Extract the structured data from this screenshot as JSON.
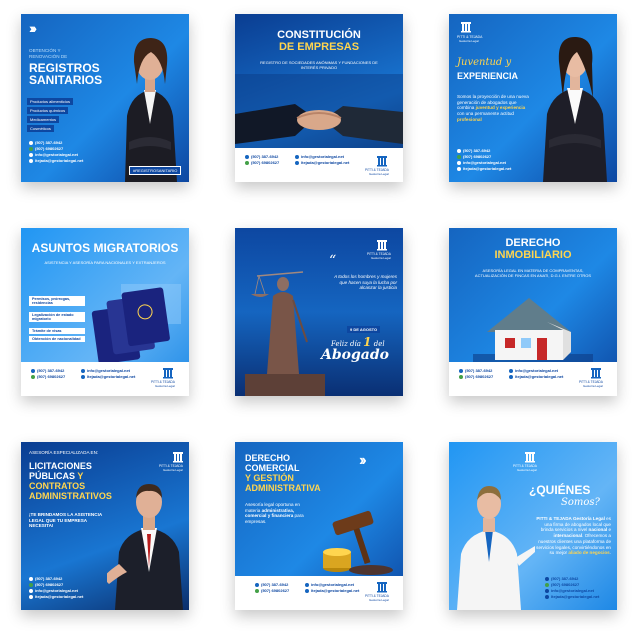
{
  "cards": {
    "c1": {
      "subtitle": "OBTENCIÓN Y RENOVACIÓN DE",
      "title1": "REGISTROS",
      "title2": "SANITARIOS",
      "items": [
        "Productos alimenticios",
        "Productos químicos",
        "Medicamentos",
        "Cosméticos"
      ],
      "phone1": "(507) 387-6942",
      "phone2": "(507) 69802627",
      "email1": "info@gestorialegal.net",
      "email2": "ltejada@gestorialegal.net",
      "hashtag": "#REGISTROSANITARIO"
    },
    "c2": {
      "title1": "CONSTITUCIÓN",
      "title2": "DE EMPRESAS",
      "subtitle": "REGISTRO DE SOCIEDADES ANÓNIMAS Y FUNDACIONES DE INTERÉS PRIVADO",
      "phone1": "(507) 387-6942",
      "phone2": "(507) 69802627",
      "email1": "info@gestorialegal.net",
      "email2": "ltejada@gestorialegal.net",
      "brand": "PITTI & TEJADA",
      "brand_sub": "Gestoría Legal"
    },
    "c3": {
      "brand": "PITTI & TEJADA",
      "brand_sub": "Gestoría Legal",
      "title1": "Juventud y",
      "title2": "EXPERIENCIA",
      "body_pre": "Somos la proyección de una nueva generación de abogados que combina",
      "body_bold": "juventud y experiencia",
      "body_mid": "con una permanente actitud",
      "body_end": "profesional",
      "phone1": "(507) 387-6942",
      "phone2": "(507) 69802627",
      "email1": "info@gestorialegal.net",
      "email2": "ltejada@gestorialegal.net"
    },
    "c4": {
      "title": "ASUNTOS MIGRATORIOS",
      "subtitle": "ASISTENCIA Y ASESORÍA PARA NACIONALES Y EXTRANJEROS",
      "items": [
        "Permisos, prórrogas, residencias",
        "Legalización de estado migratorio",
        "Trámite de visas",
        "Obtención de nacionalidad"
      ],
      "phone1": "(507) 387-6942",
      "phone2": "(507) 69802627",
      "email1": "info@gestorialegal.net",
      "email2": "ltejada@gestorialegal.net",
      "brand": "PITTI & TEJADA",
      "brand_sub": "Gestoría Legal"
    },
    "c5": {
      "quote": "A todos los hombres y mujeres que hacen suya la lucha por alcanzar la justicia",
      "date": "9 DE AGOSTO",
      "greet1": "Feliz día",
      "greet_num": "1",
      "greet2": "del",
      "greet3": "Abogado",
      "brand": "PITTI & TEJADA",
      "brand_sub": "Gestoría Legal"
    },
    "c6": {
      "title1": "DERECHO",
      "title2": "INMOBILIARIO",
      "subtitle": "ASESORÍA LEGAL EN MATERIA DE COMPRAVENTAS, ACTUALIZACIÓN DE FINCAS EN ANATI, D.G.I. ENTRE OTROS",
      "phone1": "(507) 387-6942",
      "phone2": "(507) 69802627",
      "email1": "info@gestorialegal.net",
      "email2": "ltejada@gestorialegal.net",
      "brand": "PITTI & TEJADA",
      "brand_sub": "Gestoría Legal"
    },
    "c7": {
      "top": "ASESORÍA ESPECIALIZADA EN:",
      "title1": "LICITACIONES",
      "title2": "PÚBLICAS",
      "title3": "Y",
      "title4": "CONTRATOS",
      "title5": "ADMINISTRATIVOS",
      "body": "¡TE BRINDAMOS LA ASISTENCIA LEGAL QUE TU EMPRESA NECESITA!",
      "brand": "PITTI & TEJADA",
      "brand_sub": "Gestoría Legal",
      "phone1": "(507) 387-6942",
      "phone2": "(507) 69802627",
      "email1": "info@gestorialegal.net",
      "email2": "ltejada@gestorialegal.net"
    },
    "c8": {
      "title1": "DERECHO",
      "title2": "COMERCIAL",
      "title3": "Y GESTIÓN",
      "title4": "ADMINISTRATIVA",
      "body_pre": "Asesoría legal oportuna en materia",
      "body_bold": "administrativa, comercial y financiera",
      "body_end": "para empresas.",
      "phone1": "(507) 387-6942",
      "phone2": "(507) 69802627",
      "email1": "info@gestorialegal.net",
      "email2": "ltejada@gestorialegal.net",
      "brand": "PITTI & TEJADA",
      "brand_sub": "Gestoría Legal"
    },
    "c9": {
      "brand": "PITTI & TEJADA",
      "brand_sub": "Gestoría Legal",
      "title1": "¿QUIÉNES",
      "title2": "Somos?",
      "body_brand": "PITTI & TEJADA Gestoría Legal",
      "body1": "es una firma de abogados local que brinda servicios a nivel",
      "body_bold1": "nacional",
      "body2": "e",
      "body_bold2": "internacional",
      "body3": ". Ofrecemos a nuestros clientes una plataforma de servicios legales, convirtiéndonos en su mejor",
      "body_bold3": "aliado de negocios",
      "phone1": "(507) 387-6942",
      "phone2": "(507) 69802627",
      "email1": "info@gestorialegal.net",
      "email2": "ltejada@gestorialegal.net"
    }
  },
  "colors": {
    "brand_blue": "#1565c0",
    "accent_yellow": "#ffd54f",
    "whatsapp_green": "#43a047"
  }
}
